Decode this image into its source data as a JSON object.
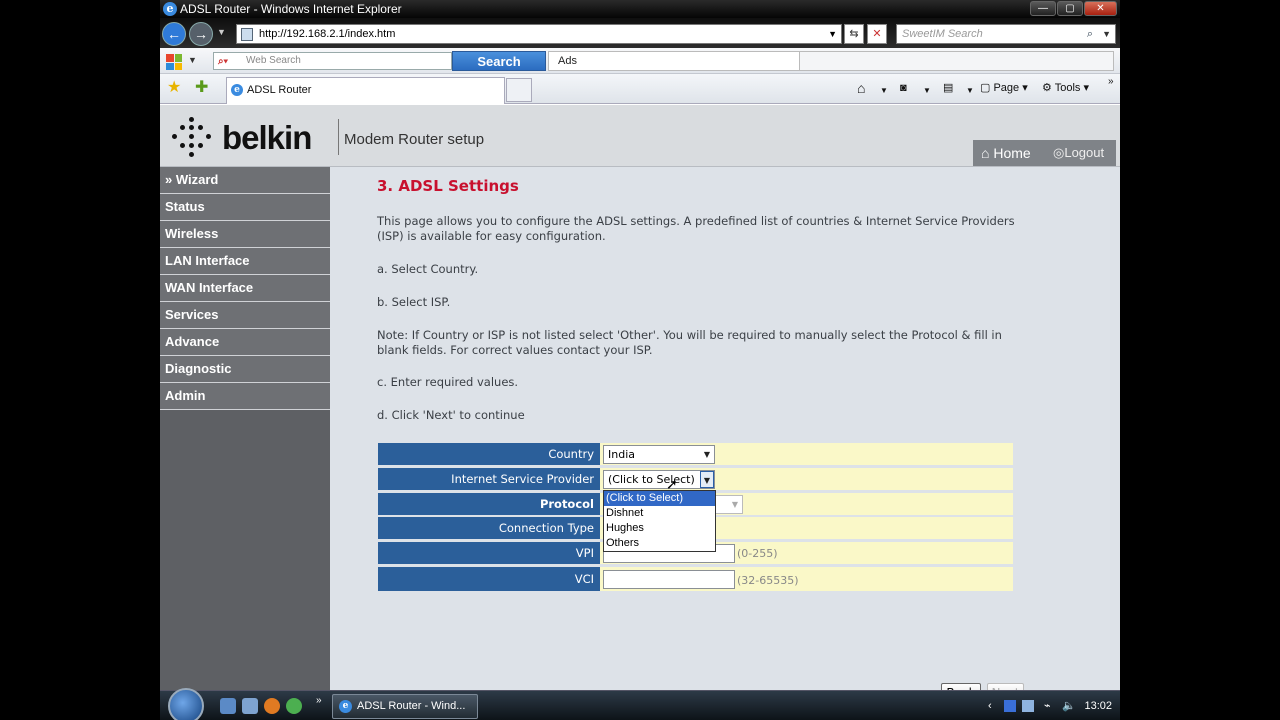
{
  "window": {
    "title": "ADSL Router - Windows Internet Explorer",
    "min": "—",
    "max": "▢",
    "close": "✕"
  },
  "addressbar": {
    "url": "http://192.168.2.1/index.htm",
    "search_placeholder": "SweetIM Search"
  },
  "toolbar": {
    "web_search_placeholder": "Web Search",
    "search_button": "Search",
    "ads_label": "Ads",
    "page_label": "Page",
    "tools_label": "Tools"
  },
  "tab": {
    "label": "ADSL Router"
  },
  "header": {
    "brand": "belkin",
    "subtitle": "Modem Router setup",
    "home": "Home",
    "logout": "Logout"
  },
  "sidebar": {
    "items": [
      {
        "label": "» Wizard"
      },
      {
        "label": "Status"
      },
      {
        "label": "Wireless"
      },
      {
        "label": "LAN Interface"
      },
      {
        "label": "WAN Interface"
      },
      {
        "label": "Services"
      },
      {
        "label": "Advance"
      },
      {
        "label": "Diagnostic"
      },
      {
        "label": "Admin"
      }
    ]
  },
  "content": {
    "title": "3. ADSL Settings",
    "intro": "This page allows you to configure the ADSL settings. A predefined list of countries & Internet Service Providers (ISP) is available for easy configuration.",
    "step_a": "a. Select Country.",
    "step_b": "b. Select ISP.",
    "note": "Note: If Country or ISP is not listed select 'Other'. You will be required to manually select the Protocol & fill in blank fields. For correct values contact your ISP.",
    "step_c": "c. Enter required values.",
    "step_d": "d. Click 'Next' to continue"
  },
  "form": {
    "country_label": "Country",
    "country_value": "India",
    "isp_label": "Internet Service Provider",
    "isp_value": "(Click to Select)",
    "protocol_label": "Protocol",
    "conn_type_label": "Connection Type",
    "vpi_label": "VPI",
    "vpi_hint": "(0-255)",
    "vci_label": "VCI",
    "vci_hint": "(32-65535)",
    "isp_options": [
      "(Click to Select)",
      "Dishnet",
      "Hughes",
      "Others"
    ]
  },
  "buttons": {
    "back": "Back",
    "next": "Next"
  },
  "taskbar": {
    "task_label": "ADSL Router - Wind...",
    "clock": "13:02"
  },
  "colors": {
    "accent_red": "#c8102e",
    "form_label_blue": "#2b5f9a",
    "form_row_yellow": "#faf8c8",
    "sidebar_gray": "#6e7074"
  }
}
